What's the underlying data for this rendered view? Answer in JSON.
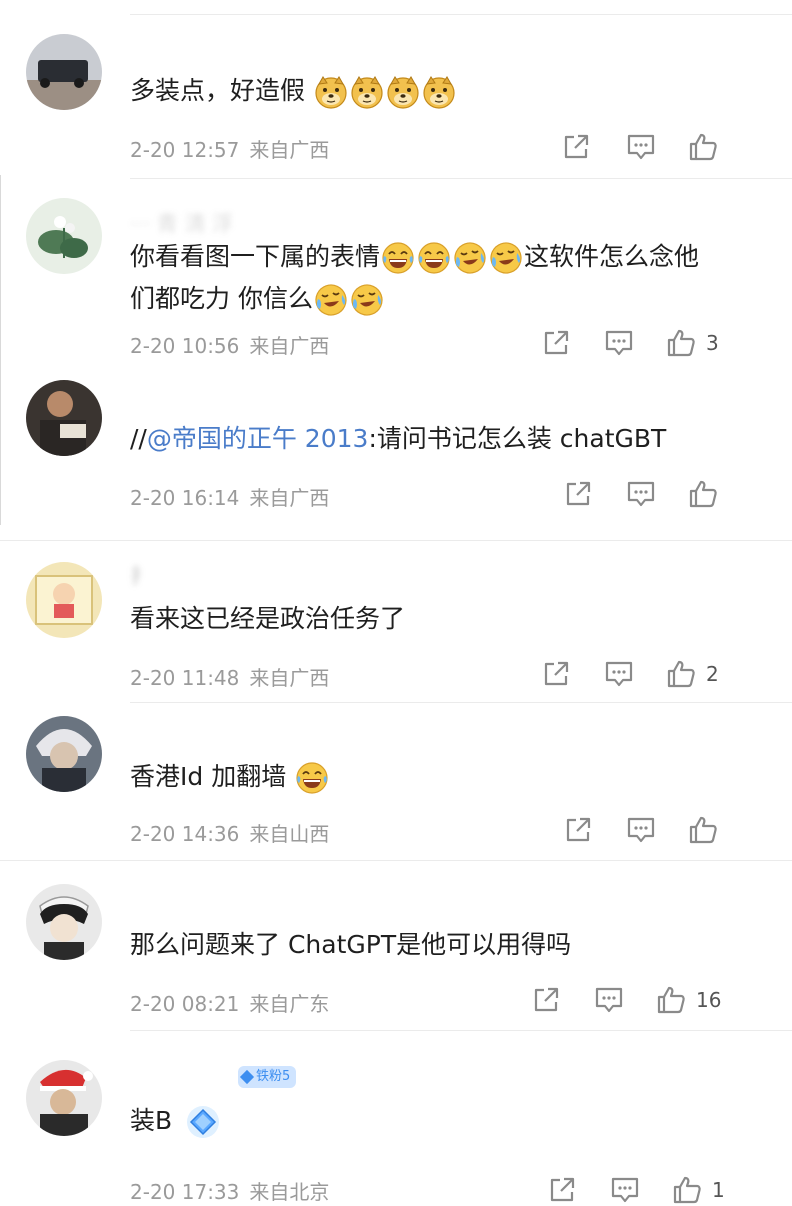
{
  "comments": [
    {
      "id": "c1",
      "username": "",
      "text": "多装点，好造假",
      "emojis": [
        "doge",
        "doge",
        "doge",
        "doge"
      ],
      "time": "2-20 12:57",
      "location": "来自广西",
      "likes": ""
    },
    {
      "id": "c2",
      "username": "··· 青 淸 浮",
      "text_line1": "你看看图一下属的表情",
      "text_line1_tail": "这软件怎么念他",
      "text_line2": "们都吃力 你信么",
      "time": "2-20 10:56",
      "location": "来自广西",
      "likes": "3"
    },
    {
      "id": "c3",
      "username": "",
      "prefix": "//",
      "mention": "@帝国的正午 2013",
      "text": ":请问书记怎么装 chatGBT",
      "time": "2-20 16:14",
      "location": "来自广西",
      "likes": ""
    },
    {
      "id": "c4",
      "username": "扌",
      "text": "看来这已经是政治任务了",
      "time": "2-20 11:48",
      "location": "来自广西",
      "likes": "2"
    },
    {
      "id": "c5",
      "username": "",
      "text": "香港Id 加翻墙",
      "time": "2-20 14:36",
      "location": "来自山西",
      "likes": ""
    },
    {
      "id": "c6",
      "username": "",
      "text": "那么问题来了 ChatGPT是他可以用得吗",
      "time": "2-20 08:21",
      "location": "来自广东",
      "likes": "16"
    },
    {
      "id": "c7",
      "username": "",
      "badge": "铁粉5",
      "text": "装B",
      "time": "2-20 17:33",
      "location": "来自北京",
      "likes": "1"
    }
  ],
  "icons": {
    "share": "share-icon",
    "comment": "comment-icon",
    "like": "thumbs-up-icon"
  },
  "colors": {
    "mention": "#4a7cc9",
    "meta": "#9a9a9a",
    "badge_bg": "#cfe4ff",
    "badge_fg": "#3d8ef0",
    "emoji": "#f7c948"
  }
}
